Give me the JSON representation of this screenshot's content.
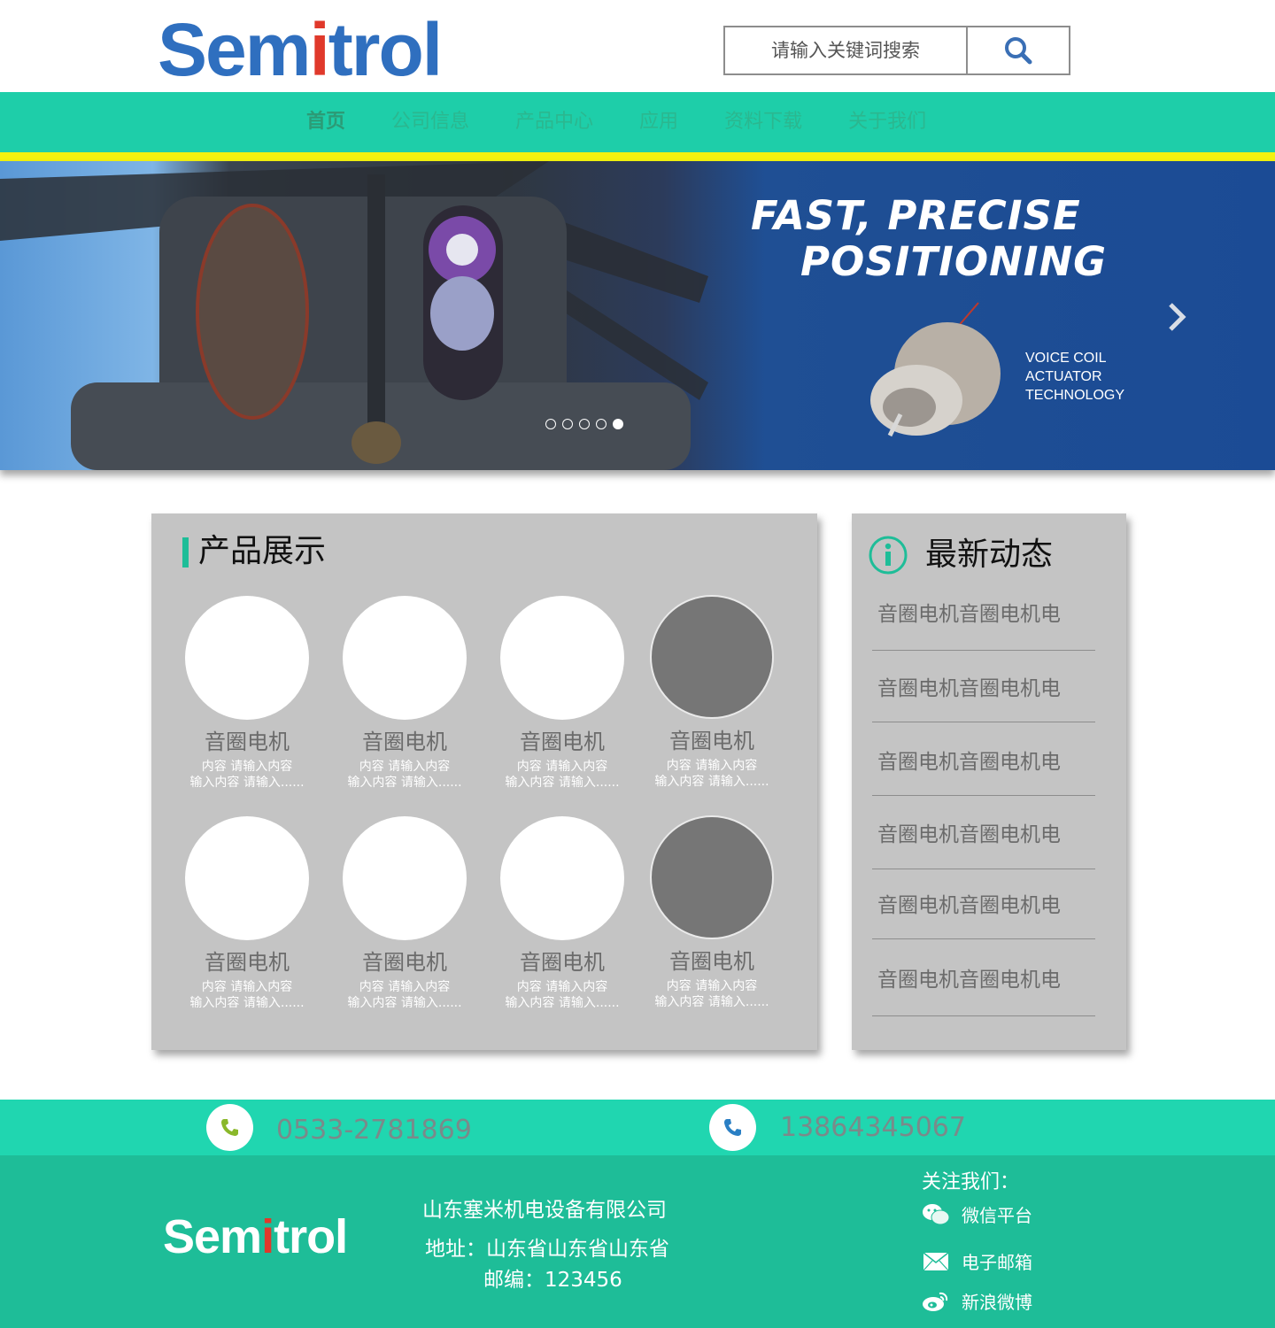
{
  "header": {
    "logo": {
      "before": "Sem",
      "dot_letter": "i",
      "after": "trol"
    },
    "search": {
      "placeholder": "请输入关键词搜索"
    }
  },
  "nav": {
    "items": [
      {
        "label": "首页",
        "active": true
      },
      {
        "label": "公司信息"
      },
      {
        "label": "产品中心"
      },
      {
        "label": "应用"
      },
      {
        "label": "资料下载"
      },
      {
        "label": "关于我们"
      }
    ]
  },
  "banner": {
    "headline_line1": "FAST, PRECISE",
    "headline_line2": "POSITIONING",
    "sub_line1": "VOICE COIL",
    "sub_line2": "ACTUATOR",
    "sub_line3": "TECHNOLOGY",
    "slide_count": 5,
    "active_slide": 5
  },
  "products": {
    "title": "产品展示",
    "items": [
      {
        "name": "音圈电机",
        "desc1": "内容 请输入内容",
        "desc2": "输入内容 请输入......",
        "image": "light"
      },
      {
        "name": "音圈电机",
        "desc1": "内容 请输入内容",
        "desc2": "输入内容 请输入......",
        "image": "light"
      },
      {
        "name": "音圈电机",
        "desc1": "内容 请输入内容",
        "desc2": "输入内容 请输入......",
        "image": "light"
      },
      {
        "name": "音圈电机",
        "desc1": "内容 请输入内容",
        "desc2": "输入内容 请输入......",
        "image": "dark"
      },
      {
        "name": "音圈电机",
        "desc1": "内容 请输入内容",
        "desc2": "输入内容 请输入......",
        "image": "light"
      },
      {
        "name": "音圈电机",
        "desc1": "内容 请输入内容",
        "desc2": "输入内容 请输入......",
        "image": "light"
      },
      {
        "name": "音圈电机",
        "desc1": "内容 请输入内容",
        "desc2": "输入内容 请输入......",
        "image": "light"
      },
      {
        "name": "音圈电机",
        "desc1": "内容 请输入内容",
        "desc2": "输入内容 请输入......",
        "image": "dark"
      }
    ]
  },
  "news": {
    "title": "最新动态",
    "icon": "info-icon",
    "items": [
      "音圈电机音圈电机电",
      "音圈电机音圈电机电",
      "音圈电机音圈电机电",
      "音圈电机音圈电机电",
      "音圈电机音圈电机电",
      "音圈电机音圈电机电"
    ]
  },
  "contact": {
    "phone1": "0533-2781869",
    "phone2": "13864345067"
  },
  "footer": {
    "company": "山东塞米机电设备有限公司",
    "address": "地址：山东省山东省山东省",
    "postcode": "邮编：123456",
    "follow_title": "关注我们：",
    "social": [
      {
        "label": "微信平台",
        "icon": "wechat-icon"
      },
      {
        "label": "电子邮箱",
        "icon": "mail-icon"
      },
      {
        "label": "新浪微博",
        "icon": "weibo-icon"
      }
    ]
  },
  "colors": {
    "brand_blue": "#2f6fbf",
    "brand_teal": "#1ecea9",
    "accent_yellow": "#f2f20f",
    "footer_teal": "#1ebd98"
  }
}
